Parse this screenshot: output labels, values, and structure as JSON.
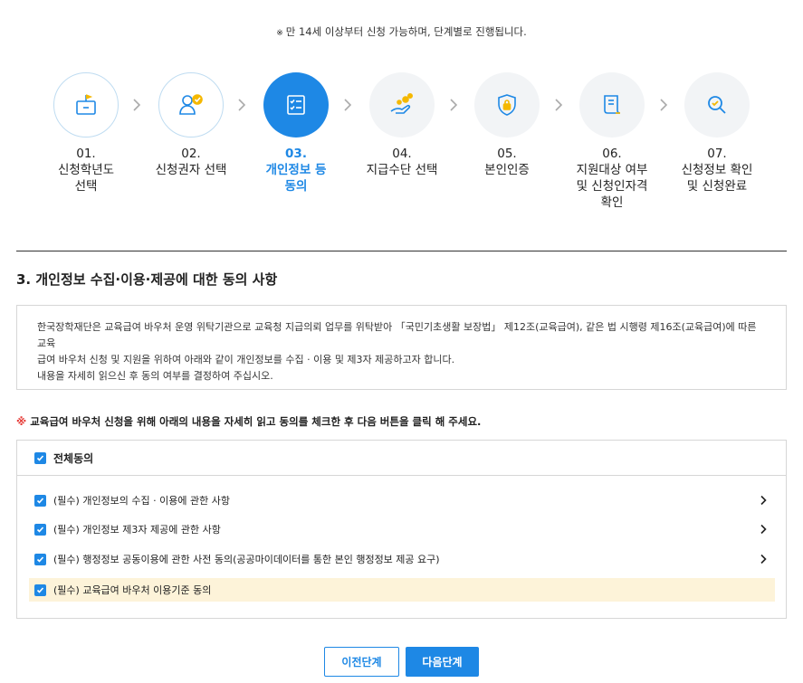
{
  "notice": {
    "mark": "※",
    "text": "만 14세 이상부터 신청 가능하며, 단계별로 진행됩니다."
  },
  "steps": [
    {
      "num": "01.",
      "label": "신청학년도 선택",
      "icon": "school-icon",
      "state": "done"
    },
    {
      "num": "02.",
      "label": "신청권자 선택",
      "icon": "user-check-icon",
      "state": "done"
    },
    {
      "num": "03.",
      "label": "개인정보 등 동의",
      "icon": "checklist-icon",
      "state": "active"
    },
    {
      "num": "04.",
      "label": "지급수단 선택",
      "icon": "hand-coins-icon",
      "state": "todo"
    },
    {
      "num": "05.",
      "label": "본인인증",
      "icon": "shield-lock-icon",
      "state": "todo"
    },
    {
      "num": "06.",
      "label": "지원대상 여부 및 신청인자격 확인",
      "icon": "document-icon",
      "state": "todo"
    },
    {
      "num": "07.",
      "label": "신청정보 확인 및 신청완료",
      "icon": "search-check-icon",
      "state": "todo"
    }
  ],
  "section_title": "3. 개인정보 수집·이용·제공에 대한 동의 사항",
  "info": {
    "line1": "한국장학재단은 교육급여 바우처 운영 위탁기관으로 교육청 지급의뢰 업무를 위탁받아 「국민기초생활 보장법」 제12조(교육급여), 같은 법 시행령 제16조(교육급여)에 따른 교육",
    "line2": "급여 바우처 신청 및 지원을 위하여 아래와 같이 개인정보를 수집 · 이용 및 제3자 제공하고자 합니다.",
    "line3": "내용을 자세히 읽으신 후 동의 여부를 결정하여 주십시오."
  },
  "instruction": {
    "star": "※",
    "text": "교육급여 바우처 신청을 위해 아래의 내용을 자세히 읽고 동의를 체크한 후 다음 버튼을 클릭 해 주세요."
  },
  "agreements": {
    "all_label": "전체동의",
    "items": [
      {
        "label": "(필수) 개인정보의 수집 · 이용에 관한 사항"
      },
      {
        "label": "(필수) 개인정보 제3자 제공에 관한 사항"
      },
      {
        "label": "(필수) 행정정보 공동이용에 관한 사전 동의(공공마이데이터를 통한 본인 행정정보 제공 요구)"
      },
      {
        "label": "(필수) 교육급여 바우처 이용기준 동의"
      }
    ]
  },
  "buttons": {
    "prev": "이전단계",
    "next": "다음단계"
  },
  "colors": {
    "accent": "#1e88e5",
    "highlight": "#fdf3d9",
    "required_star": "#e53935"
  }
}
